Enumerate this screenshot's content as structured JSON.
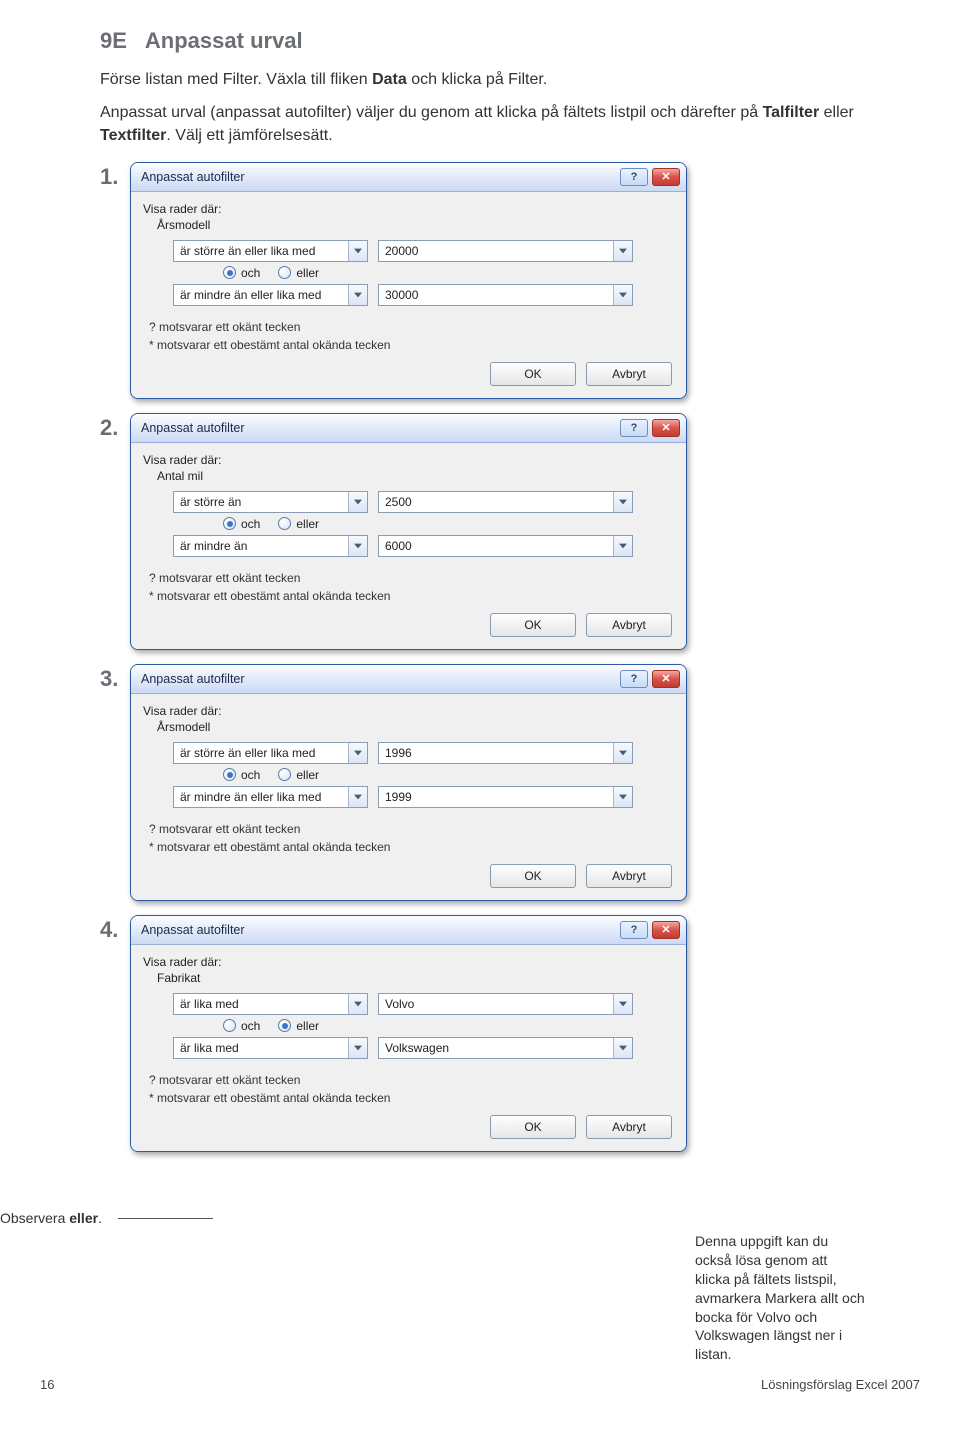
{
  "section": {
    "index": "9E",
    "title": "Anpassat urval"
  },
  "para1_pre": "Förse listan med Filter. Växla till fliken ",
  "para1_b1": "Data",
  "para1_mid": " och klicka på Filter.",
  "para2_a": "Anpassat urval (anpassat autofilter) väljer du genom att klicka på fältets listpil och därefter på ",
  "para2_b1": "Talfilter",
  "para2_mid": " eller ",
  "para2_b2": "Textfilter",
  "para2_end": ". Välj ett jämförelsesätt.",
  "nums": {
    "n1": "1.",
    "n2": "2.",
    "n3": "3.",
    "n4": "4."
  },
  "dlg": {
    "title": "Anpassat autofilter",
    "showrows": "Visa rader där:",
    "hint1": "? motsvarar ett okänt tecken",
    "hint2": "* motsvarar ett obestämt antal okända tecken",
    "ok": "OK",
    "cancel": "Avbryt",
    "och": "och",
    "eller": "eller"
  },
  "dlgs": [
    {
      "field": "Årsmodell",
      "op1": "är större än eller lika med",
      "v1": "20000",
      "op2": "är mindre än eller lika med",
      "v2": "30000",
      "checked": "och"
    },
    {
      "field": "Antal mil",
      "op1": "är större än",
      "v1": "2500",
      "op2": "är mindre än",
      "v2": "6000",
      "checked": "och"
    },
    {
      "field": "Årsmodell",
      "op1": "är större än eller lika med",
      "v1": "1996",
      "op2": "är mindre än eller lika med",
      "v2": "1999",
      "checked": "och"
    },
    {
      "field": "Fabrikat",
      "op1": "är lika med",
      "v1": "Volvo",
      "op2": "är lika med",
      "v2": "Volkswagen",
      "checked": "eller"
    }
  ],
  "annotLeft_a": "Observera ",
  "annotLeft_b": "eller",
  "annotLeft_c": ".",
  "annotRight": "Denna uppgift kan du också lösa genom att klicka på fältets listspil, avmarkera Markera allt och bocka för Volvo och Volkswagen längst ner i listan.",
  "footer": {
    "page": "16",
    "src": "Lösningsförslag Excel 2007"
  }
}
